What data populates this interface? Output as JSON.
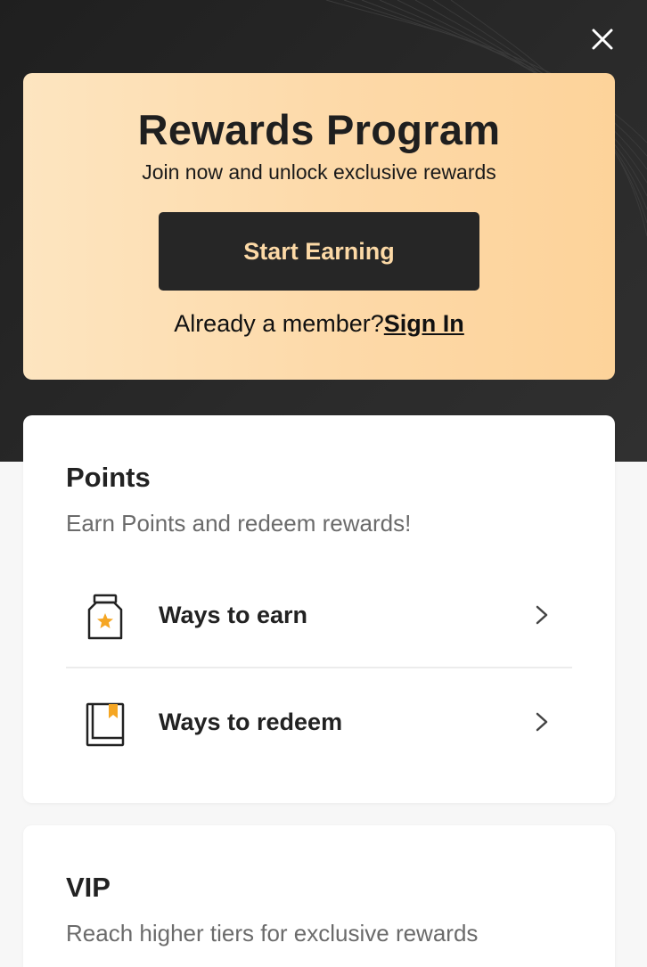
{
  "hero": {
    "title": "Rewards Program",
    "subtitle": "Join now and unlock exclusive rewards",
    "cta_label": "Start Earning",
    "member_prompt": "Already a member?",
    "signin_label": "Sign In"
  },
  "points": {
    "title": "Points",
    "subtitle": "Earn Points and redeem rewards!",
    "rows": [
      {
        "label": "Ways to earn",
        "icon": "jar-star-icon"
      },
      {
        "label": "Ways to redeem",
        "icon": "bookmark-book-icon"
      }
    ]
  },
  "vip": {
    "title": "VIP",
    "subtitle": "Reach higher tiers for exclusive rewards"
  },
  "colors": {
    "dark_bg": "#262626",
    "accent_gold": "#fcd9a6",
    "icon_accent": "#f5a623"
  }
}
